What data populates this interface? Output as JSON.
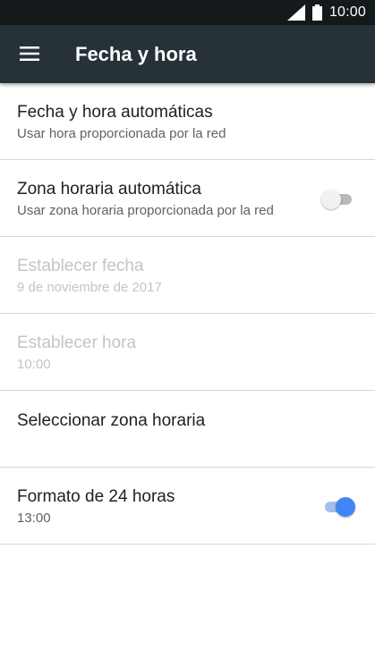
{
  "status_bar": {
    "time": "10:00",
    "icons": [
      "signal-icon",
      "battery-icon"
    ]
  },
  "app_bar": {
    "title": "Fecha y hora",
    "menu_icon": "hamburger-icon"
  },
  "colors": {
    "status_bar": "#14191c",
    "app_bar": "#263238",
    "toggle_on": "#4285f4",
    "toggle_off": "#f1f1f1"
  },
  "settings": [
    {
      "title": "Fecha y hora automáticas",
      "summary": "Usar hora proporcionada por la red",
      "enabled": true
    },
    {
      "title": "Zona horaria automática",
      "summary": "Usar zona horaria proporcionada por la red",
      "enabled": true,
      "toggle": false
    },
    {
      "title": "Establecer fecha",
      "summary": "9 de noviembre de 2017",
      "enabled": false
    },
    {
      "title": "Establecer hora",
      "summary": "10:00",
      "enabled": false
    },
    {
      "title": "Seleccionar zona horaria",
      "enabled": true
    },
    {
      "title": "Formato de 24 horas",
      "summary": "13:00",
      "enabled": true,
      "toggle": true
    }
  ]
}
